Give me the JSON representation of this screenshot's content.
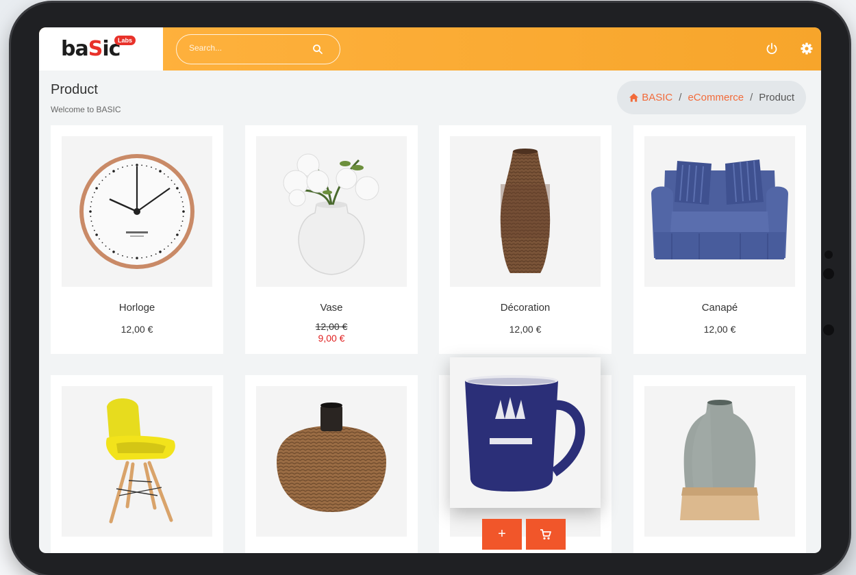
{
  "brand": {
    "name_prefix": "ba",
    "name_s": "S",
    "name_suffix": "ic",
    "badge": "Labs"
  },
  "search": {
    "placeholder": "Search..."
  },
  "header": {
    "power_icon": "power-icon",
    "settings_icon": "gear-icon"
  },
  "page": {
    "title": "Product",
    "subtitle": "Welcome to BASIC"
  },
  "breadcrumb": {
    "home": "BASIC",
    "section": "eCommerce",
    "current": "Product",
    "separator": "/"
  },
  "products": [
    {
      "name": "Horloge",
      "price": "12,00 €"
    },
    {
      "name": "Vase",
      "old_price": "12,00 €",
      "price": "9,00 €"
    },
    {
      "name": "Décoration",
      "price": "12,00 €"
    },
    {
      "name": "Canapé",
      "price": "12,00 €"
    },
    {
      "name": "",
      "price": ""
    },
    {
      "name": "",
      "price": ""
    },
    {
      "name": "",
      "price": ""
    },
    {
      "name": "",
      "price": ""
    }
  ],
  "hover_actions": {
    "add_label": "+",
    "cart_icon": "cart-icon"
  },
  "colors": {
    "accent": "#f7a52b",
    "action": "#f1562a",
    "link": "#f26b3a",
    "sale": "#e02020"
  }
}
